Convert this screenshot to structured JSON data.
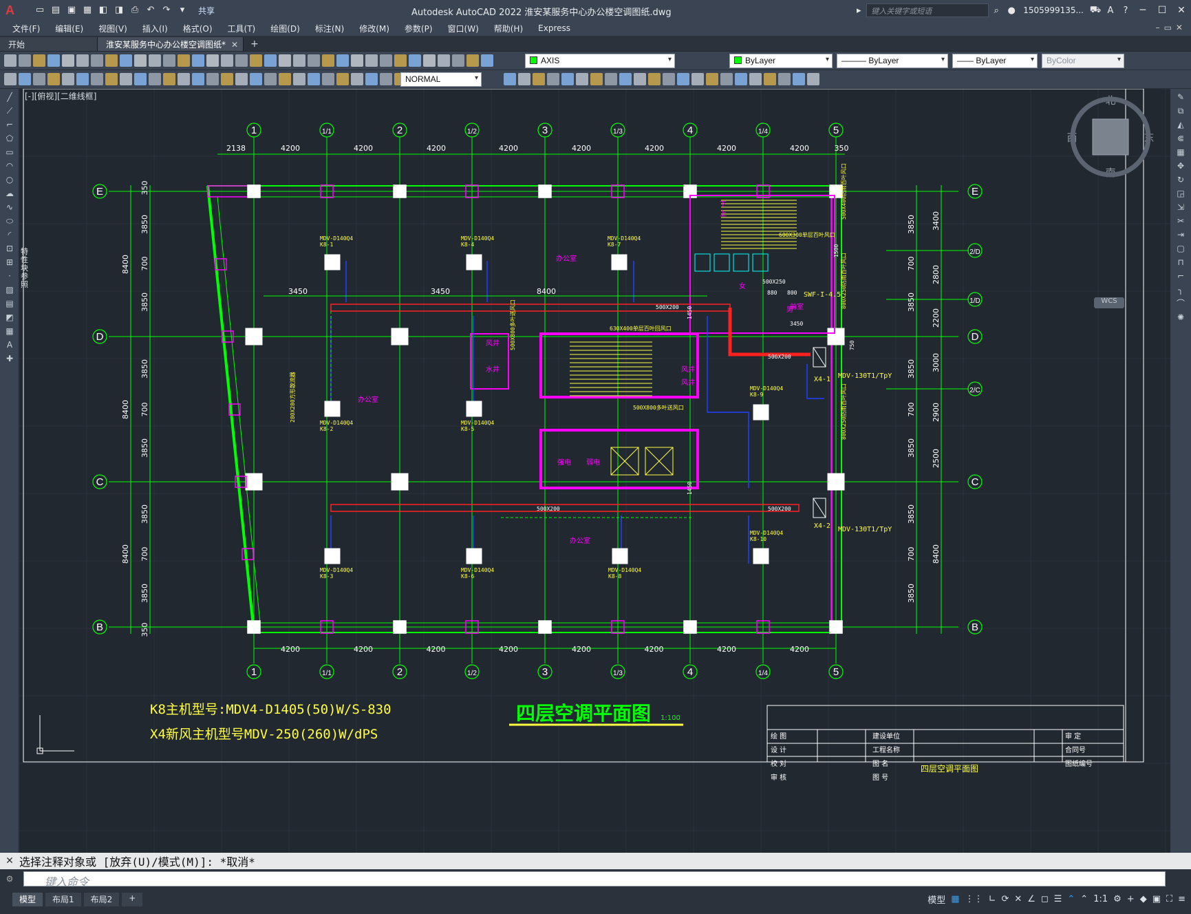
{
  "app": {
    "logo": "A",
    "title": "Autodesk AutoCAD 2022    淮安某服务中心办公楼空调图纸.dwg",
    "share": "共享",
    "search_placeholder": "键入关键字或短语",
    "user": "1505999135..."
  },
  "menu": [
    "文件(F)",
    "编辑(E)",
    "视图(V)",
    "插入(I)",
    "格式(O)",
    "工具(T)",
    "绘图(D)",
    "标注(N)",
    "修改(M)",
    "参数(P)",
    "窗口(W)",
    "帮助(H)",
    "Express"
  ],
  "tabs": {
    "start": "开始",
    "active": "淮安某服务中心办公楼空调图纸*"
  },
  "toolbar": {
    "layer": "AXIS",
    "color": "ByLayer",
    "linetype": "ByLayer",
    "lineweight": "ByLayer",
    "plotstyle": "ByColor",
    "textstyle": "NORMAL"
  },
  "viewport": {
    "label": "[-][俯视][二维线框]",
    "palette_label": "特性 块参照",
    "compass": {
      "north": "北",
      "south": "南",
      "east": "东",
      "west": "西",
      "top": "上",
      "wcs": "WCS"
    }
  },
  "drawing": {
    "grid_top": [
      "1",
      "1/1",
      "2",
      "1/2",
      "3",
      "1/3",
      "4",
      "1/4",
      "5"
    ],
    "grid_side": [
      "E",
      "D",
      "C",
      "B"
    ],
    "grid_right_extra": [
      "2/D",
      "1/D",
      "2/C"
    ],
    "top_dims": [
      "2138",
      "4200",
      "4200",
      "4200",
      "4200",
      "4200",
      "4200",
      "4200",
      "4200",
      "350"
    ],
    "bottom_dims": [
      "4200",
      "4200",
      "4200",
      "4200",
      "4200",
      "4200",
      "4200",
      "4200"
    ],
    "left_dims_outer": [
      "8400",
      "8400",
      "8400"
    ],
    "left_dims_inner": [
      "350",
      "3850",
      "700",
      "3850",
      "3850",
      "700",
      "3850",
      "3850",
      "700",
      "3850",
      "350"
    ],
    "right_dims_outer": [
      "3400",
      "2800",
      "2200",
      "3000",
      "2900",
      "2500",
      "8400"
    ],
    "right_dims_inner": [
      "3850",
      "700",
      "3850",
      "3850",
      "700",
      "3850",
      "3850",
      "700",
      "3850"
    ],
    "duct_dims": [
      "3450",
      "3450",
      "8400"
    ],
    "units": [
      {
        "model": "MDV-D140Q4",
        "tag": "K8-1"
      },
      {
        "model": "MDV-D140Q4",
        "tag": "K8-4"
      },
      {
        "model": "MDV-D140Q4",
        "tag": "K8-7"
      },
      {
        "model": "MDV-D140Q4",
        "tag": "K8-2"
      },
      {
        "model": "MDV-D140Q4",
        "tag": "K8-5"
      },
      {
        "model": "MDV-D140Q4",
        "tag": "K8-9"
      },
      {
        "model": "MDV-D140Q4",
        "tag": "K8-3"
      },
      {
        "model": "MDV-D140Q4",
        "tag": "K8-6"
      },
      {
        "model": "MDV-D140Q4",
        "tag": "K8-8"
      },
      {
        "model": "MDV-D140Q4",
        "tag": "K8-10"
      }
    ],
    "rooms": [
      "办公室",
      "办公室",
      "办公室",
      "风井",
      "水井",
      "风井",
      "风井",
      "前室",
      "强电",
      "弱电",
      "女",
      "男",
      "下",
      "上"
    ],
    "duct_labels": [
      "500X200",
      "500X200",
      "500X200",
      "500X200",
      "500X250",
      "630X400单层百叶回风口",
      "500X800多叶送风口",
      "500X800多叶送风口",
      "280X280方形散流器",
      "600X300单层百叶风口",
      "500X400防雨百叶风口",
      "800X250防雨百叶风口",
      "800X250防雨百叶风口",
      "1500",
      "1450",
      "1450",
      "880",
      "800",
      "750",
      "3450"
    ],
    "equipment": [
      "SWF-I-4.5",
      "X4-1",
      "MDV-130T1/TpY",
      "X4-2",
      "MDV-130T1/TpY"
    ],
    "notes": [
      "K8主机型号:MDV4-D1405(50)W/S-830",
      "X4新风主机型号MDV-250(260)W/dPS"
    ],
    "plan_title": "四层空调平面图",
    "plan_scale": "1:100",
    "title_block": {
      "left": [
        "绘  图",
        "设  计",
        "校  对",
        "审  核"
      ],
      "mid": [
        "建设单位",
        "工程名称",
        "图  名",
        "图  号"
      ],
      "name": "四层空调平面图",
      "right": [
        "审  定",
        "合同号",
        "图纸编号"
      ]
    }
  },
  "command": {
    "history": "选择注释对象或 [放弃(U)/模式(M)]: *取消*",
    "placeholder": "键入命令"
  },
  "status": {
    "layouts": [
      "模型",
      "布局1",
      "布局2"
    ],
    "model": "模型",
    "scale": "1:1"
  },
  "colors": {
    "background": "#212830",
    "axis": "#00ff00",
    "wall": "#ff00ff",
    "duct_red": "#ff2020",
    "pipe_blue": "#2040ff",
    "yellow": "#ffff40",
    "cyan": "#00ffff"
  }
}
